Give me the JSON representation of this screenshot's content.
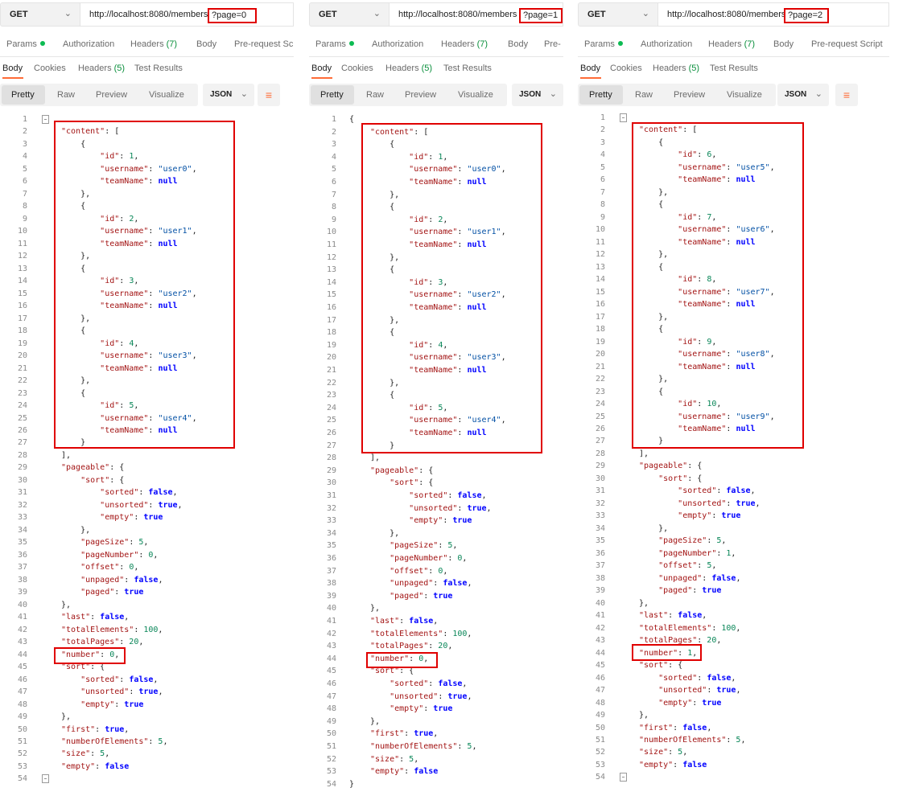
{
  "method": "GET",
  "url_base": "http://localhost:8080/members",
  "request_tabs": {
    "params": "Params",
    "authorization": "Authorization",
    "headers": "Headers",
    "headers_count": "(7)",
    "body": "Body",
    "prerequest": "Pre-request Script"
  },
  "response_tabs": {
    "body": "Body",
    "cookies": "Cookies",
    "headers": "Headers",
    "headers_count": "(5)",
    "test_results": "Test Results"
  },
  "view_modes": [
    "Pretty",
    "Raw",
    "Preview",
    "Visualize"
  ],
  "format": "JSON",
  "panels": [
    {
      "query": "?page=0",
      "users": [
        [
          "1",
          "user0"
        ],
        [
          "2",
          "user1"
        ],
        [
          "3",
          "user2"
        ],
        [
          "4",
          "user3"
        ],
        [
          "5",
          "user4"
        ]
      ],
      "pageNumber": "0",
      "offset": "0",
      "last": "false",
      "number": "0",
      "first": "true",
      "empty": "false"
    },
    {
      "query": "?page=1",
      "users": [
        [
          "1",
          "user0"
        ],
        [
          "2",
          "user1"
        ],
        [
          "3",
          "user2"
        ],
        [
          "4",
          "user3"
        ],
        [
          "5",
          "user4"
        ]
      ],
      "pageNumber": "0",
      "offset": "0",
      "last": "false",
      "number": "0",
      "first": "true",
      "empty": "false"
    },
    {
      "query": "?page=2",
      "users": [
        [
          "6",
          "user5"
        ],
        [
          "7",
          "user6"
        ],
        [
          "8",
          "user7"
        ],
        [
          "9",
          "user8"
        ],
        [
          "10",
          "user9"
        ]
      ],
      "pageNumber": "1",
      "offset": "5",
      "last": "false",
      "number": "1",
      "first": "false",
      "empty": "false"
    }
  ],
  "common": {
    "pageSize": "5",
    "totalElements": "100",
    "totalPages": "20",
    "numberOfElements": "5",
    "size": "5"
  }
}
